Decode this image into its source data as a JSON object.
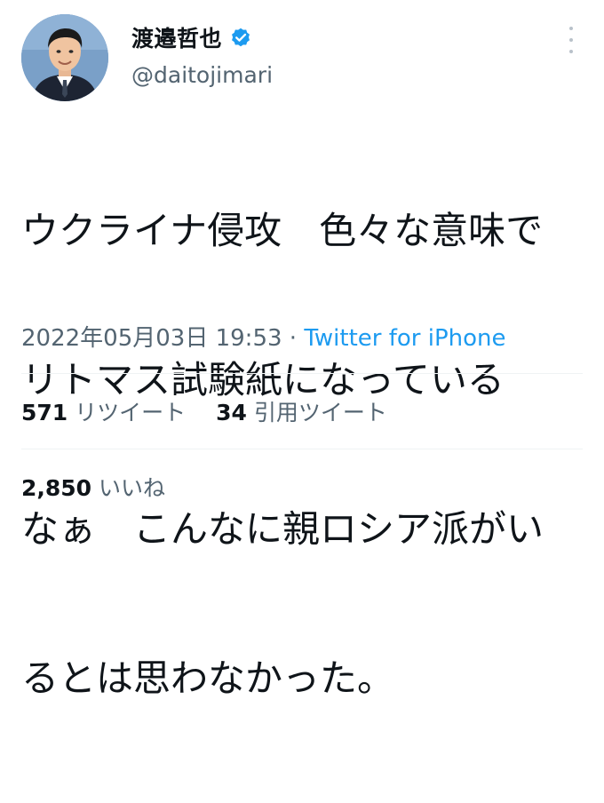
{
  "user": {
    "display_name": "渡邉哲也",
    "handle": "@daitojimari",
    "verified": true,
    "verified_color": "#1d9bf0"
  },
  "tweet": {
    "text_lines": [
      "ウクライナ侵攻　色々な意味で",
      "リトマス試験紙になっている",
      "なぁ　こんなに親ロシア派がい",
      "るとは思わなかった。"
    ],
    "timestamp": "2022年05月03日 19:53",
    "separator": " · ",
    "source": "Twitter for iPhone"
  },
  "stats": {
    "retweets_count": "571",
    "retweets_label": "リツイート",
    "quotes_count": "34",
    "quotes_label": "引用ツイート",
    "likes_count": "2,850",
    "likes_label": "いいね"
  },
  "colors": {
    "text": "#0f1419",
    "secondary": "#536471",
    "link": "#1d9bf0",
    "divider": "#eff3f4"
  }
}
